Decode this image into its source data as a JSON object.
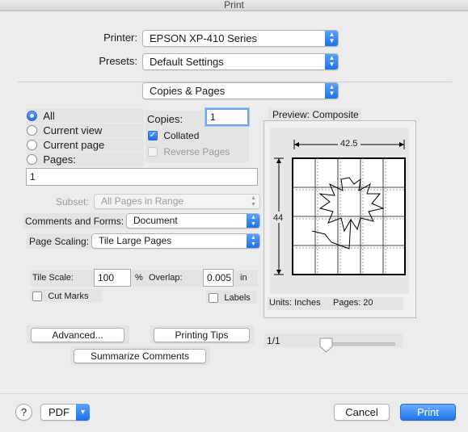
{
  "window": {
    "title": "Print"
  },
  "printer": {
    "label": "Printer:",
    "value": "EPSON XP-410 Series"
  },
  "presets": {
    "label": "Presets:",
    "value": "Default Settings"
  },
  "section": {
    "value": "Copies & Pages"
  },
  "pages": {
    "all_label": "All",
    "current_view_label": "Current view",
    "current_page_label": "Current page",
    "pages_label": "Pages:",
    "pages_value": "1",
    "selected": "All"
  },
  "copies": {
    "label": "Copies:",
    "value": "1",
    "collated_label": "Collated",
    "collated": true,
    "reverse_label": "Reverse Pages",
    "reverse": false
  },
  "subset": {
    "label": "Subset:",
    "value": "All Pages in Range"
  },
  "comments": {
    "label": "Comments and Forms:",
    "value": "Document"
  },
  "scaling": {
    "label": "Page Scaling:",
    "value": "Tile Large Pages"
  },
  "tile": {
    "scale_label": "Tile Scale:",
    "scale_value": "100",
    "percent": "%",
    "overlap_label": "Overlap:",
    "overlap_value": "0.005",
    "overlap_unit": "in",
    "cut_marks_label": "Cut Marks",
    "labels_label": "Labels"
  },
  "preview": {
    "title": "Preview: Composite",
    "width_label": "42.5",
    "height_label": "44",
    "units_label": "Units: Inches",
    "pages_count": "Pages: 20",
    "page_indicator": "1/1"
  },
  "buttons": {
    "advanced": "Advanced...",
    "printing_tips": "Printing Tips",
    "summarize": "Summarize Comments",
    "help": "?",
    "pdf": "PDF",
    "cancel": "Cancel",
    "print": "Print"
  },
  "colors": {
    "accent": "#1d73ea",
    "background": "#ececec"
  },
  "icons": {
    "popup_arrow": "up-down-chevron-icon",
    "pdf_menu": "chevron-down-icon",
    "help": "question-icon"
  }
}
